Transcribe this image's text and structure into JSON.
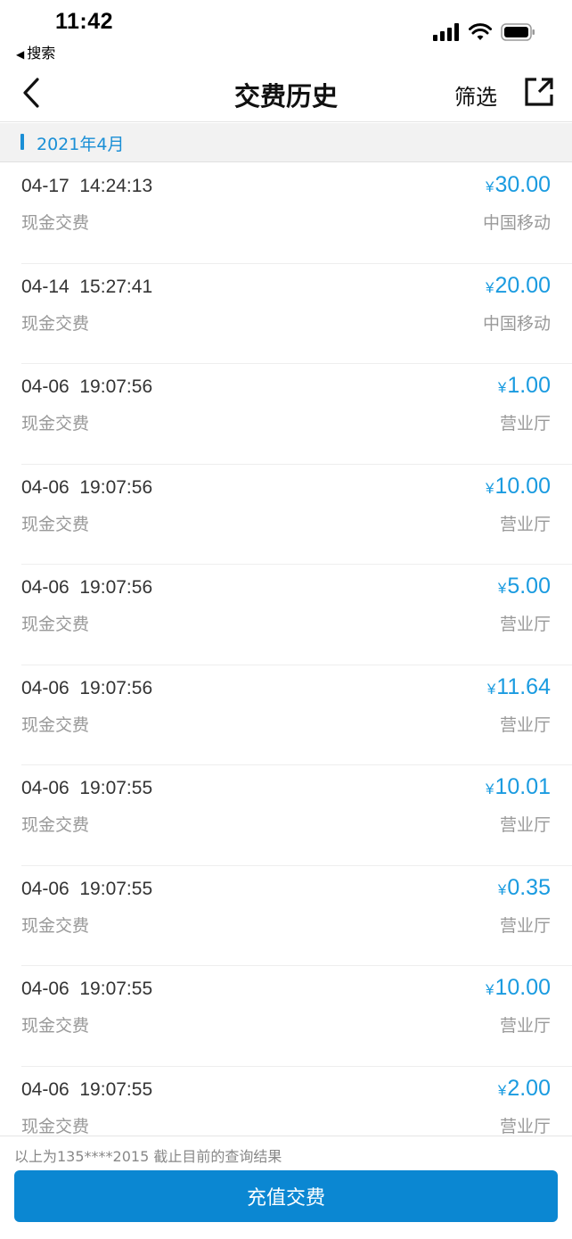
{
  "status_bar": {
    "time": "11:42",
    "back_label": "搜索",
    "back_icon": "◀",
    "icons": [
      "signal-icon",
      "wifi-icon",
      "battery-icon"
    ]
  },
  "nav": {
    "title": "交费历史",
    "filter_label": "筛选",
    "back_icon": "chevron-left-icon",
    "share_icon": "share-icon"
  },
  "section": {
    "title": "2021年4月"
  },
  "currency_symbol": "¥",
  "colors": {
    "accent": "#1a9be0",
    "button": "#0b87d2"
  },
  "records": [
    {
      "time": "04-17  14:24:13",
      "type": "现金交费",
      "amount": "30.00",
      "channel": "中国移动"
    },
    {
      "time": "04-14  15:27:41",
      "type": "现金交费",
      "amount": "20.00",
      "channel": "中国移动"
    },
    {
      "time": "04-06  19:07:56",
      "type": "现金交费",
      "amount": "1.00",
      "channel": "营业厅"
    },
    {
      "time": "04-06  19:07:56",
      "type": "现金交费",
      "amount": "10.00",
      "channel": "营业厅"
    },
    {
      "time": "04-06  19:07:56",
      "type": "现金交费",
      "amount": "5.00",
      "channel": "营业厅"
    },
    {
      "time": "04-06  19:07:56",
      "type": "现金交费",
      "amount": "11.64",
      "channel": "营业厅"
    },
    {
      "time": "04-06  19:07:55",
      "type": "现金交费",
      "amount": "10.01",
      "channel": "营业厅"
    },
    {
      "time": "04-06  19:07:55",
      "type": "现金交费",
      "amount": "0.35",
      "channel": "营业厅"
    },
    {
      "time": "04-06  19:07:55",
      "type": "现金交费",
      "amount": "10.00",
      "channel": "营业厅"
    },
    {
      "time": "04-06  19:07:55",
      "type": "现金交费",
      "amount": "2.00",
      "channel": "营业厅"
    }
  ],
  "footer": {
    "note": "以上为135****2015 截止目前的查询结果",
    "button_label": "充值交费"
  }
}
